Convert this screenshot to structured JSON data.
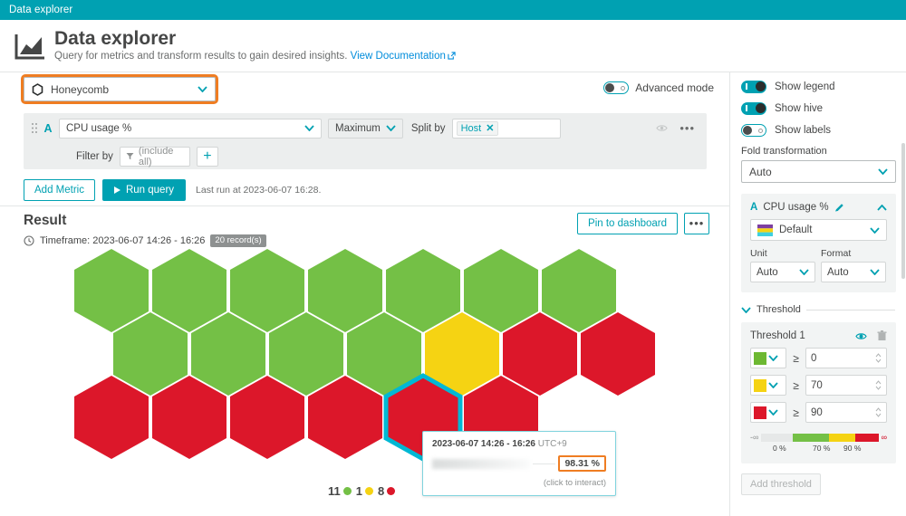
{
  "titlebar": {
    "title": "Data explorer"
  },
  "header": {
    "title": "Data explorer",
    "subtitle": "Query for metrics and transform results to gain desired insights.",
    "doc_link": "View Documentation",
    "icon": "chart-icon",
    "external_link_icon": "external-link-icon"
  },
  "visualization": {
    "selected": "Honeycomb",
    "icon": "hexagon-icon",
    "chevron": "chevron-down-icon"
  },
  "advanced_mode": {
    "label": "Advanced mode",
    "state": "off"
  },
  "query": {
    "letter": "A",
    "metric": "CPU usage %",
    "aggregation": "Maximum",
    "split_by_label": "Split by",
    "split_by_chips": [
      {
        "label": "Host",
        "remove": "✕"
      }
    ],
    "filter_label": "Filter by",
    "filter_placeholder": "(include all)",
    "add_filter": "+",
    "eye_icon": "eye-icon",
    "more_icon": "more-options-icon",
    "drag_icon": "drag-handle-icon"
  },
  "actions": {
    "add_metric": "Add Metric",
    "run_query": "Run query",
    "last_run": "Last run at 2023-06-07 16:28."
  },
  "result": {
    "title": "Result",
    "clock_icon": "clock-icon",
    "timeframe": "Timeframe: 2023-06-07 14:26 - 16:26",
    "record_badge": "20 record(s)",
    "pin_button": "Pin to dashboard",
    "more_button": "…"
  },
  "tooltip": {
    "time_range": "2023-06-07 14:26 - 16:26",
    "timezone": "UTC+9",
    "value": "98.31 %",
    "hint": "(click to interact)"
  },
  "legend": {
    "items": [
      {
        "count": "11",
        "color": "#74c046"
      },
      {
        "count": "1",
        "color": "#f5d313"
      },
      {
        "count": "8",
        "color": "#dc172a"
      }
    ]
  },
  "sidebar": {
    "toggles": [
      {
        "label": "Show legend",
        "state": "on"
      },
      {
        "label": "Show hive",
        "state": "on"
      },
      {
        "label": "Show labels",
        "state": "off"
      }
    ],
    "fold_transformation": {
      "label": "Fold transformation",
      "value": "Auto"
    },
    "metric_panel": {
      "letter": "A",
      "name": "CPU usage %",
      "edit_icon": "pencil-icon",
      "collapse_icon": "chevron-up-icon",
      "palette": "Default",
      "unit_label": "Unit",
      "unit_value": "Auto",
      "format_label": "Format",
      "format_value": "Auto"
    },
    "threshold_section": {
      "section_label": "Threshold",
      "panel_title": "Threshold 1",
      "visibility_icon": "eye-icon",
      "delete_icon": "trash-icon",
      "rows": [
        {
          "color": "#6db832",
          "operator": "≥",
          "value": "0"
        },
        {
          "color": "#f5d313",
          "operator": "≥",
          "value": "70"
        },
        {
          "color": "#dc172a",
          "operator": "≥",
          "value": "90"
        }
      ],
      "gradient_min": "-∞",
      "gradient_max": "∞",
      "gradient_ticks": [
        "0 %",
        "70 %",
        "90 %"
      ],
      "add_threshold": "Add threshold"
    }
  },
  "chart_data": {
    "type": "honeycomb",
    "title": "CPU usage % by Host",
    "metric": "CPU usage %",
    "aggregation": "Maximum",
    "split_by": "Host",
    "timeframe": "2023-06-07 14:26 - 16:26",
    "record_count": 20,
    "thresholds": [
      {
        "min": 0,
        "color": "#74c046",
        "label": "green"
      },
      {
        "min": 70,
        "color": "#f5d313",
        "label": "yellow"
      },
      {
        "min": 90,
        "color": "#dc172a",
        "label": "red"
      }
    ],
    "counts": {
      "green": 11,
      "yellow": 1,
      "red": 8
    },
    "selected_cell": {
      "row": 2,
      "col": 4,
      "value": 98.31,
      "unit": "%"
    },
    "rows": [
      {
        "row": 0,
        "cells": [
          "green",
          "green",
          "green",
          "green",
          "green",
          "green",
          "green"
        ]
      },
      {
        "row": 1,
        "cells": [
          "green",
          "green",
          "green",
          "green",
          "yellow",
          "red",
          "red"
        ]
      },
      {
        "row": 2,
        "cells": [
          "red",
          "red",
          "red",
          "red",
          "red",
          "red"
        ]
      }
    ]
  }
}
